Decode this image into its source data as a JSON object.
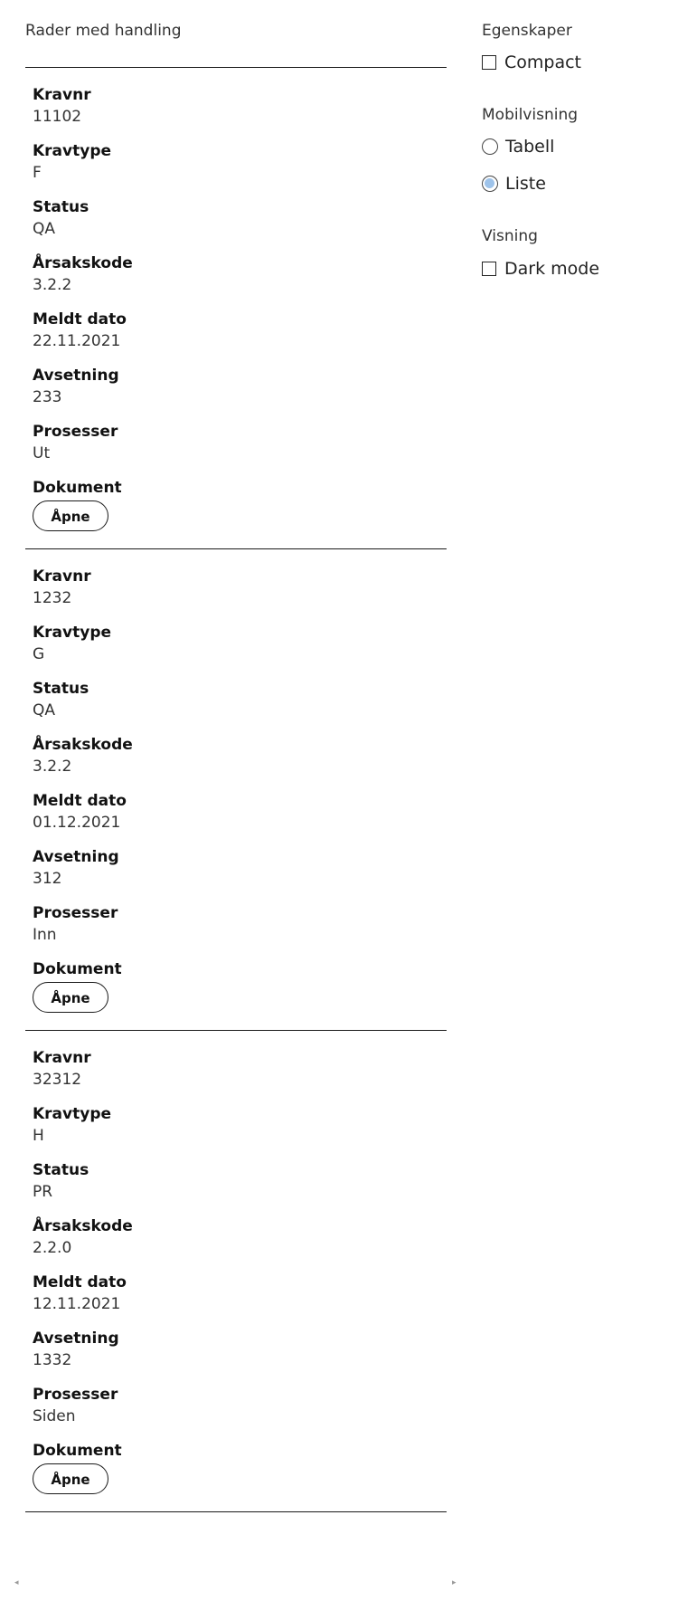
{
  "table": {
    "caption": "Rader med handling",
    "rows": [
      {
        "fields": [
          {
            "label": "Kravnr",
            "value": "11102"
          },
          {
            "label": "Kravtype",
            "value": "F"
          },
          {
            "label": "Status",
            "value": "QA"
          },
          {
            "label": "Årsakskode",
            "value": "3.2.2"
          },
          {
            "label": "Meldt dato",
            "value": "22.11.2021"
          },
          {
            "label": "Avsetning",
            "value": "233"
          },
          {
            "label": "Prosesser",
            "value": "Ut"
          }
        ],
        "document_label": "Dokument",
        "button_label": "Åpne"
      },
      {
        "fields": [
          {
            "label": "Kravnr",
            "value": "1232"
          },
          {
            "label": "Kravtype",
            "value": "G"
          },
          {
            "label": "Status",
            "value": "QA"
          },
          {
            "label": "Årsakskode",
            "value": "3.2.2"
          },
          {
            "label": "Meldt dato",
            "value": "01.12.2021"
          },
          {
            "label": "Avsetning",
            "value": "312"
          },
          {
            "label": "Prosesser",
            "value": "Inn"
          }
        ],
        "document_label": "Dokument",
        "button_label": "Åpne"
      },
      {
        "fields": [
          {
            "label": "Kravnr",
            "value": "32312"
          },
          {
            "label": "Kravtype",
            "value": "H"
          },
          {
            "label": "Status",
            "value": "PR"
          },
          {
            "label": "Årsakskode",
            "value": "2.2.0"
          },
          {
            "label": "Meldt dato",
            "value": "12.11.2021"
          },
          {
            "label": "Avsetning",
            "value": "1332"
          },
          {
            "label": "Prosesser",
            "value": "Siden"
          }
        ],
        "document_label": "Dokument",
        "button_label": "Åpne"
      }
    ]
  },
  "settings": {
    "properties": {
      "title": "Egenskaper",
      "compact_label": "Compact",
      "compact_checked": false
    },
    "mobile_view": {
      "title": "Mobilvisning",
      "options": [
        {
          "label": "Tabell",
          "checked": false
        },
        {
          "label": "Liste",
          "checked": true
        }
      ]
    },
    "display": {
      "title": "Visning",
      "dark_mode_label": "Dark mode",
      "dark_mode_checked": false
    }
  },
  "scrollbar": {
    "left_arrow": "◂",
    "right_arrow": "▸"
  },
  "colors": {
    "radio_selected_fill": "#9ec3ea",
    "text": "#1a1a1a",
    "border": "#1a1a1a"
  }
}
